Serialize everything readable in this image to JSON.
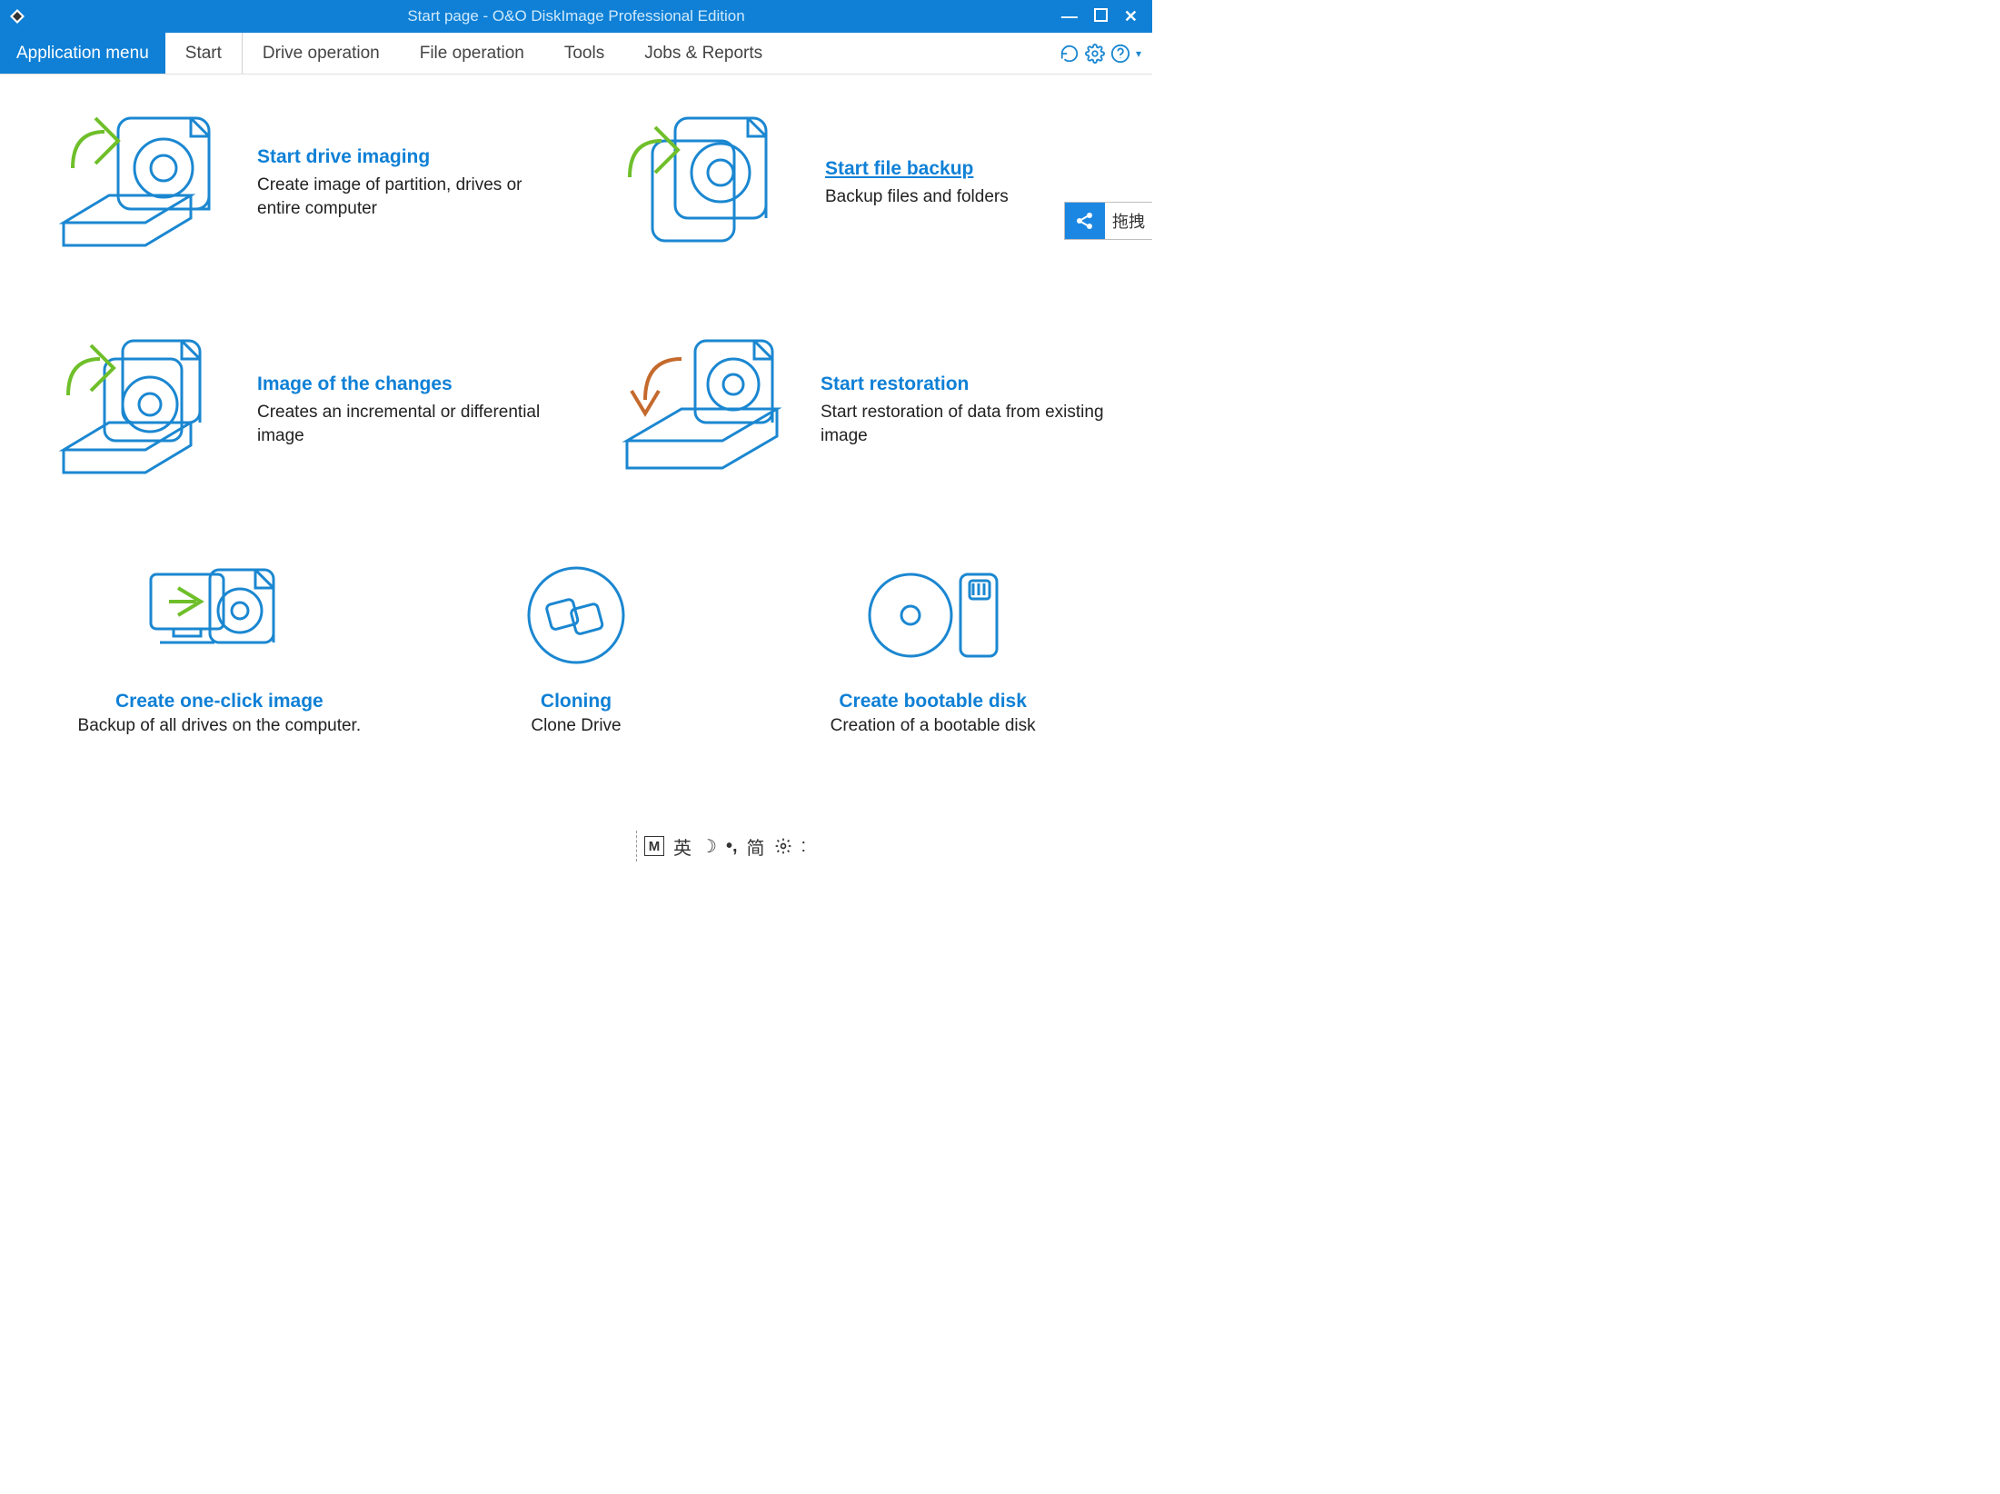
{
  "titlebar": {
    "title": "Start page - O&O DiskImage Professional Edition"
  },
  "menu": {
    "app_menu": "Application menu",
    "tabs": [
      {
        "label": "Start",
        "active": true
      },
      {
        "label": "Drive operation"
      },
      {
        "label": "File operation"
      },
      {
        "label": "Tools"
      },
      {
        "label": "Jobs & Reports"
      }
    ]
  },
  "main_actions": [
    {
      "title": "Start drive imaging",
      "desc": "Create image of partition, drives or entire computer"
    },
    {
      "title": "Start file backup",
      "desc": "Backup files and folders"
    },
    {
      "title": "Image of the changes",
      "desc": "Creates an incremental or differential image"
    },
    {
      "title": "Start restoration",
      "desc": "Start restoration of data from existing image"
    }
  ],
  "bottom_actions": [
    {
      "title": "Create one-click image",
      "desc": "Backup of all drives on the computer."
    },
    {
      "title": "Cloning",
      "desc": "Clone Drive"
    },
    {
      "title": "Create bootable disk",
      "desc": "Creation of a bootable disk"
    }
  ],
  "float_widget": {
    "label": "拖拽"
  },
  "ime": {
    "mode_letter": "M",
    "lang": "英",
    "style": "简"
  }
}
